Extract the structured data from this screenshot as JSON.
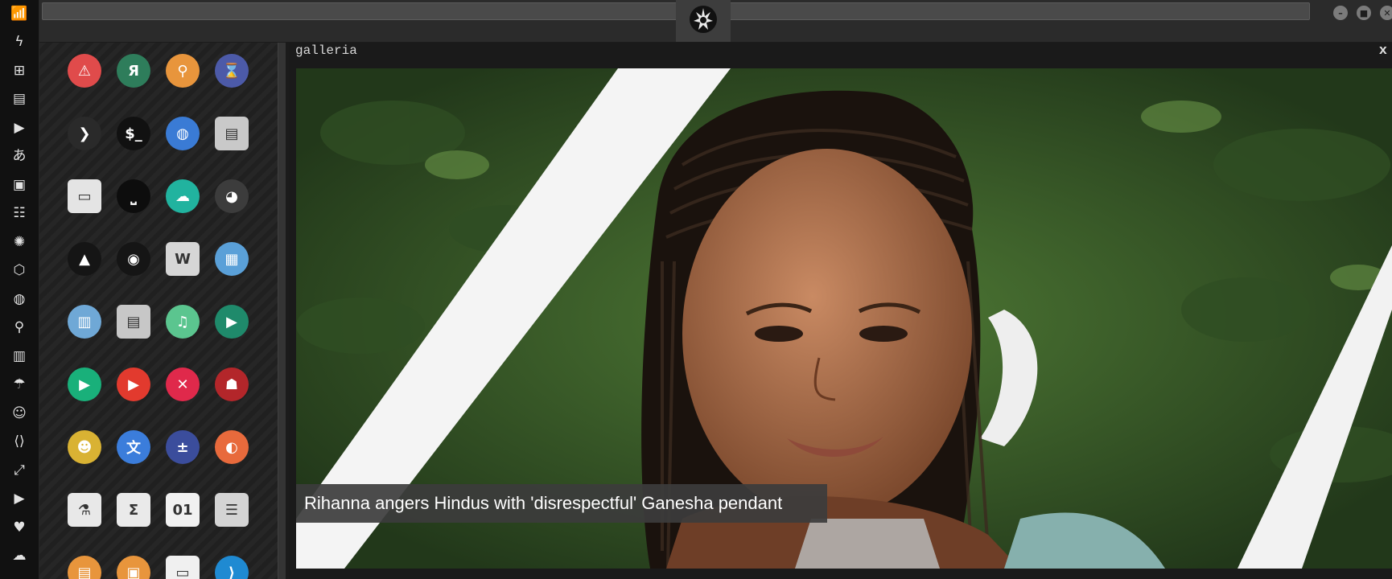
{
  "window": {
    "title": "galleria",
    "close_label": "x"
  },
  "topbar": {
    "emblem_icon": "rebel-alliance-icon",
    "controls": [
      "minimize-icon",
      "maximize-icon",
      "close-icon"
    ]
  },
  "dock": {
    "items": [
      {
        "name": "wifi-icon",
        "glyph": "📶"
      },
      {
        "name": "bolt-icon",
        "glyph": "ϟ"
      },
      {
        "name": "windows-icon",
        "glyph": "⊞"
      },
      {
        "name": "archive-icon",
        "glyph": "▤"
      },
      {
        "name": "play-circle-icon",
        "glyph": "▶"
      },
      {
        "name": "translate-icon",
        "glyph": "あ"
      },
      {
        "name": "image-icon",
        "glyph": "▣"
      },
      {
        "name": "newspaper-icon",
        "glyph": "☷"
      },
      {
        "name": "jedi-order-icon",
        "glyph": "✺"
      },
      {
        "name": "empire-icon",
        "glyph": "⬡"
      },
      {
        "name": "globe-icon",
        "glyph": "◍"
      },
      {
        "name": "search-icon",
        "glyph": "⚲"
      },
      {
        "name": "map-icon",
        "glyph": "▥"
      },
      {
        "name": "umbrella-icon",
        "glyph": "☂"
      },
      {
        "name": "contacts-icon",
        "glyph": "☺"
      },
      {
        "name": "code-icon",
        "glyph": "⟨⟩"
      },
      {
        "name": "fullscreen-icon",
        "glyph": "⤢"
      },
      {
        "name": "youtube-icon",
        "glyph": "▶"
      },
      {
        "name": "heart-icon",
        "glyph": "♥"
      },
      {
        "name": "cloud-icon",
        "glyph": "☁"
      }
    ]
  },
  "launcher": {
    "apps": [
      {
        "name": "warning-app-icon",
        "glyph": "⚠",
        "color": "#e04b4b"
      },
      {
        "name": "yandex-app-icon",
        "glyph": "Я",
        "color": "#2e7d5b"
      },
      {
        "name": "search-app-icon",
        "glyph": "⚲",
        "color": "#e8953c"
      },
      {
        "name": "hourglass-app-icon",
        "glyph": "⌛",
        "color": "#4c5aa8"
      },
      {
        "name": "chevron-app-icon",
        "glyph": "❯",
        "color": "#2a2a2a"
      },
      {
        "name": "terminal-app-icon",
        "glyph": "$_",
        "color": "#111111"
      },
      {
        "name": "web-browser-app-icon",
        "glyph": "◍",
        "color": "#3a7bd5"
      },
      {
        "name": "file-cabinet-app-icon",
        "glyph": "▤",
        "color": "#c9c9c9"
      },
      {
        "name": "window-app-icon",
        "glyph": "▭",
        "color": "#e4e4e4"
      },
      {
        "name": "keyboard-app-icon",
        "glyph": "⎵",
        "color": "#0d0d0d"
      },
      {
        "name": "cloud-lock-app-icon",
        "glyph": "☁",
        "color": "#21b39f"
      },
      {
        "name": "github-app-icon",
        "glyph": "◕",
        "color": "#3c3c3c"
      },
      {
        "name": "starfleet-app-icon",
        "glyph": "▲",
        "color": "#151515"
      },
      {
        "name": "death-star-app-icon",
        "glyph": "◉",
        "color": "#151515"
      },
      {
        "name": "wikipedia-app-icon",
        "glyph": "W",
        "color": "#d6d6d6"
      },
      {
        "name": "world-map-app-icon",
        "glyph": "▦",
        "color": "#5aa0d8"
      },
      {
        "name": "books-app-icon",
        "glyph": "▥",
        "color": "#6fa8d6"
      },
      {
        "name": "notebook-app-icon",
        "glyph": "▤",
        "color": "#c7c7c7"
      },
      {
        "name": "music-app-icon",
        "glyph": "♫",
        "color": "#5bc58f"
      },
      {
        "name": "video-app-icon",
        "glyph": "▶",
        "color": "#1f8a6b"
      },
      {
        "name": "media-player-app-icon",
        "glyph": "▶",
        "color": "#19b07a"
      },
      {
        "name": "youtube-app-icon",
        "glyph": "▶",
        "color": "#e23a2e"
      },
      {
        "name": "close-circle-app-icon",
        "glyph": "✕",
        "color": "#e0294b"
      },
      {
        "name": "iron-man-app-icon",
        "glyph": "☗",
        "color": "#b3262a"
      },
      {
        "name": "c3po-app-icon",
        "glyph": "☻",
        "color": "#d9b233"
      },
      {
        "name": "translate-app-icon",
        "glyph": "文",
        "color": "#3b7ddb"
      },
      {
        "name": "calculator-app-icon",
        "glyph": "±",
        "color": "#3b4d9c"
      },
      {
        "name": "color-palette-app-icon",
        "glyph": "◐",
        "color": "#e86a3c"
      },
      {
        "name": "chemistry-app-icon",
        "glyph": "⚗",
        "color": "#e8e8e8"
      },
      {
        "name": "sigma-app-icon",
        "glyph": "Σ",
        "color": "#eaeaea"
      },
      {
        "name": "binary-file-app-icon",
        "glyph": "01",
        "color": "#f1f1f1"
      },
      {
        "name": "text-editor-app-icon",
        "glyph": "☰",
        "color": "#d4d4d4"
      },
      {
        "name": "document-app-icon",
        "glyph": "▤",
        "color": "#e8953c"
      },
      {
        "name": "image-viewer-app-icon",
        "glyph": "▣",
        "color": "#e8953c"
      },
      {
        "name": "presentation-app-icon",
        "glyph": "▭",
        "color": "#f0f0f0"
      },
      {
        "name": "vscode-app-icon",
        "glyph": "⟩",
        "color": "#1f8ad2"
      }
    ]
  },
  "slide": {
    "caption": "Rihanna angers Hindus with 'disrespectful' Ganesha pendant",
    "image_subject": "photo-of-woman-with-braids"
  }
}
